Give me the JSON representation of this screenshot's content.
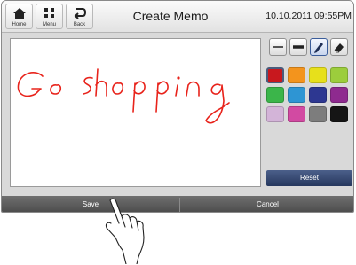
{
  "topbar": {
    "home_label": "Home",
    "menu_label": "Menu",
    "back_label": "Back",
    "title": "Create Memo",
    "datetime": "10.10.2011 09:55PM"
  },
  "canvas": {
    "handwriting_text": "Go shopping",
    "ink_color": "#e8231b"
  },
  "tools": {
    "icons": [
      "thin-line-icon",
      "thick-line-icon",
      "pen-icon",
      "eraser-icon"
    ],
    "selected": "pen-icon"
  },
  "palette": {
    "colors": [
      "#c8181e",
      "#f3941d",
      "#e7e01b",
      "#9ccd3c",
      "#3bb54a",
      "#2e95d3",
      "#2d3791",
      "#8e2a8f",
      "#d3b4d8",
      "#d24aa2",
      "#7d7d7d",
      "#151515"
    ],
    "selected_index": 0
  },
  "reset_label": "Reset",
  "bottombar": {
    "save_label": "Save",
    "cancel_label": "Cancel"
  }
}
